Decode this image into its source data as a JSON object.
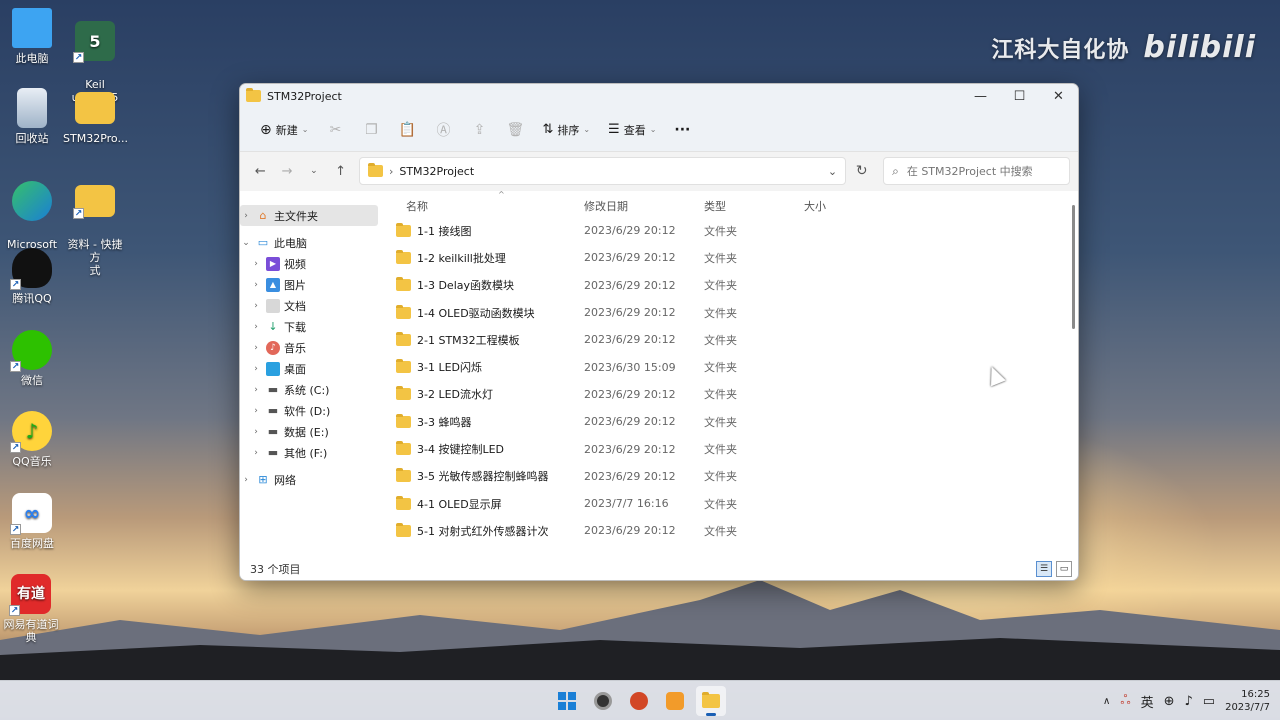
{
  "watermark": {
    "text": "江科大自化协",
    "brand": "bilibili"
  },
  "desktop": {
    "icons": [
      {
        "label": "此电脑"
      },
      {
        "label": "Keil\nuVision5",
        "badge": "5"
      },
      {
        "label": "回收站"
      },
      {
        "label": "STM32Pro..."
      },
      {
        "label": "Microsoft\nEdge"
      },
      {
        "label": "资料 - 快捷方\n式"
      },
      {
        "label": "腾讯QQ"
      },
      {
        "label": "微信"
      },
      {
        "label": "QQ音乐"
      },
      {
        "label": "百度网盘"
      },
      {
        "label": "网易有道词典",
        "badge": "有道"
      }
    ]
  },
  "window": {
    "title": "STM32Project",
    "controls": {
      "minimize": "—",
      "maximize": "☐",
      "close": "✕"
    }
  },
  "command_bar": {
    "new_label": "新建",
    "sort_label": "排序",
    "view_label": "查看",
    "more_label": "···"
  },
  "address_bar": {
    "path": "STM32Project",
    "search_placeholder": "在 STM32Project 中搜索"
  },
  "nav_pane": {
    "items": [
      {
        "label": "主文件夹",
        "icon": "home-icon"
      },
      {
        "label": "此电脑",
        "icon": "computer-icon"
      },
      {
        "label": "视频",
        "icon": "video-icon"
      },
      {
        "label": "图片",
        "icon": "picture-icon"
      },
      {
        "label": "文档",
        "icon": "document-icon"
      },
      {
        "label": "下载",
        "icon": "download-icon"
      },
      {
        "label": "音乐",
        "icon": "music-icon"
      },
      {
        "label": "桌面",
        "icon": "desktop-icon"
      },
      {
        "label": "系统 (C:)",
        "icon": "drive-icon"
      },
      {
        "label": "软件 (D:)",
        "icon": "drive-icon"
      },
      {
        "label": "数据 (E:)",
        "icon": "drive-icon"
      },
      {
        "label": "其他 (F:)",
        "icon": "drive-icon"
      },
      {
        "label": "网络",
        "icon": "network-icon"
      }
    ]
  },
  "file_list": {
    "columns": {
      "name": "名称",
      "date": "修改日期",
      "type": "类型",
      "size": "大小"
    },
    "rows": [
      {
        "name": "1-1 接线图",
        "date": "2023/6/29 20:12",
        "type": "文件夹"
      },
      {
        "name": "1-2 keilkill批处理",
        "date": "2023/6/29 20:12",
        "type": "文件夹"
      },
      {
        "name": "1-3 Delay函数模块",
        "date": "2023/6/29 20:12",
        "type": "文件夹"
      },
      {
        "name": "1-4 OLED驱动函数模块",
        "date": "2023/6/29 20:12",
        "type": "文件夹"
      },
      {
        "name": "2-1 STM32工程模板",
        "date": "2023/6/29 20:12",
        "type": "文件夹"
      },
      {
        "name": "3-1 LED闪烁",
        "date": "2023/6/30 15:09",
        "type": "文件夹"
      },
      {
        "name": "3-2 LED流水灯",
        "date": "2023/6/29 20:12",
        "type": "文件夹"
      },
      {
        "name": "3-3 蜂鸣器",
        "date": "2023/6/29 20:12",
        "type": "文件夹"
      },
      {
        "name": "3-4 按键控制LED",
        "date": "2023/6/29 20:12",
        "type": "文件夹"
      },
      {
        "name": "3-5 光敏传感器控制蜂鸣器",
        "date": "2023/6/29 20:12",
        "type": "文件夹"
      },
      {
        "name": "4-1 OLED显示屏",
        "date": "2023/7/7 16:16",
        "type": "文件夹"
      },
      {
        "name": "5-1 对射式红外传感器计次",
        "date": "2023/6/29 20:12",
        "type": "文件夹"
      }
    ]
  },
  "status_bar": {
    "count": "33 个项目"
  },
  "taskbar": {
    "tray": {
      "ime": "英",
      "time": "16:25",
      "date": "2023/7/7"
    }
  }
}
